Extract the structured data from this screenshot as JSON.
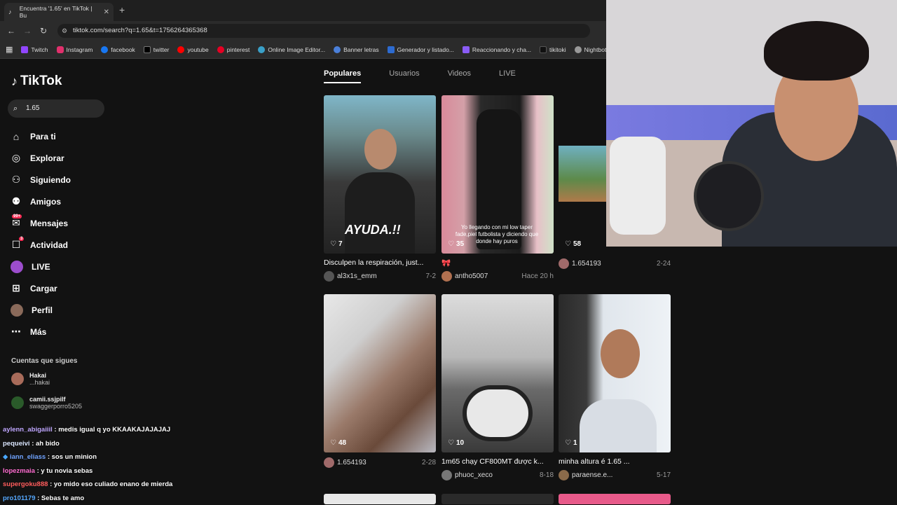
{
  "browser": {
    "tab_title": "Encuentra '1.65' en TikTok | Bu",
    "url": "tiktok.com/search?q=1.65&t=1756264365368",
    "bookmarks": [
      "Twitch",
      "Instagram",
      "facebook",
      "twitter",
      "youtube",
      "pinterest",
      "Online Image Editor...",
      "Banner letras",
      "Generador y listado...",
      "Reaccionando y cha...",
      "tikitoki",
      "Nightbot - Com"
    ]
  },
  "sidebar": {
    "logo": "TikTok",
    "search_value": "1.65",
    "nav": [
      {
        "label": "Para ti",
        "icon": "home-icon"
      },
      {
        "label": "Explorar",
        "icon": "compass-icon"
      },
      {
        "label": "Siguiendo",
        "icon": "following-icon"
      },
      {
        "label": "Amigos",
        "icon": "friends-icon"
      },
      {
        "label": "Mensajes",
        "icon": "messages-icon",
        "badge": "99+"
      },
      {
        "label": "Actividad",
        "icon": "activity-icon",
        "badge": "3"
      },
      {
        "label": "LIVE",
        "icon": "live-icon"
      },
      {
        "label": "Cargar",
        "icon": "upload-icon"
      },
      {
        "label": "Perfil",
        "icon": "profile-icon"
      },
      {
        "label": "Más",
        "icon": "more-icon"
      }
    ],
    "following_header": "Cuentas que sigues",
    "following": [
      {
        "name": "Hakai",
        "user": "...hakai"
      },
      {
        "name": "camii.ssjpilf",
        "user": "swaggerporro5205"
      }
    ]
  },
  "content_tabs": [
    "Populares",
    "Usuarios",
    "Videos",
    "LIVE"
  ],
  "videos": [
    {
      "likes": "7",
      "caption": "Disculpen la respiración, just...",
      "user": "al3x1s_emm",
      "date": "7-2",
      "overlay": "AYUDA.!!"
    },
    {
      "likes": "35",
      "caption": "🎀",
      "user": "antho5007",
      "date": "Hace 20 h",
      "overlay": "Yo llegando con mi low taper fade,piel futbolista y diciendo que donde hay puros"
    },
    {
      "likes": "58",
      "caption": "",
      "user": "1.654193",
      "date": "2-24"
    },
    {
      "likes": "48",
      "caption": "",
      "user": "1.654193",
      "date": "2-28"
    },
    {
      "likes": "10",
      "caption": "1m65 chạy CF800MT được k...",
      "user": "phuoc_xeco",
      "date": "8-18"
    },
    {
      "likes": "1",
      "caption": "minha altura é 1.65 ...",
      "user": "paraense.e...",
      "date": "5-17"
    }
  ],
  "chat": [
    {
      "user": "aylenn_abigaiiil",
      "msg": ": medis igual q yo KKAAKAJAJAJAJ"
    },
    {
      "user": "pequeivi",
      "msg": ": ah bido"
    },
    {
      "user": "iann_eliass",
      "msg": ": sos un minion"
    },
    {
      "user": "lopezmaia",
      "msg": ": y tu novia sebas"
    },
    {
      "user": "supergoku888",
      "msg": ": yo mido eso culiado enano de mierda"
    },
    {
      "user": "pro101179",
      "msg": ": Sebas te amo"
    }
  ]
}
